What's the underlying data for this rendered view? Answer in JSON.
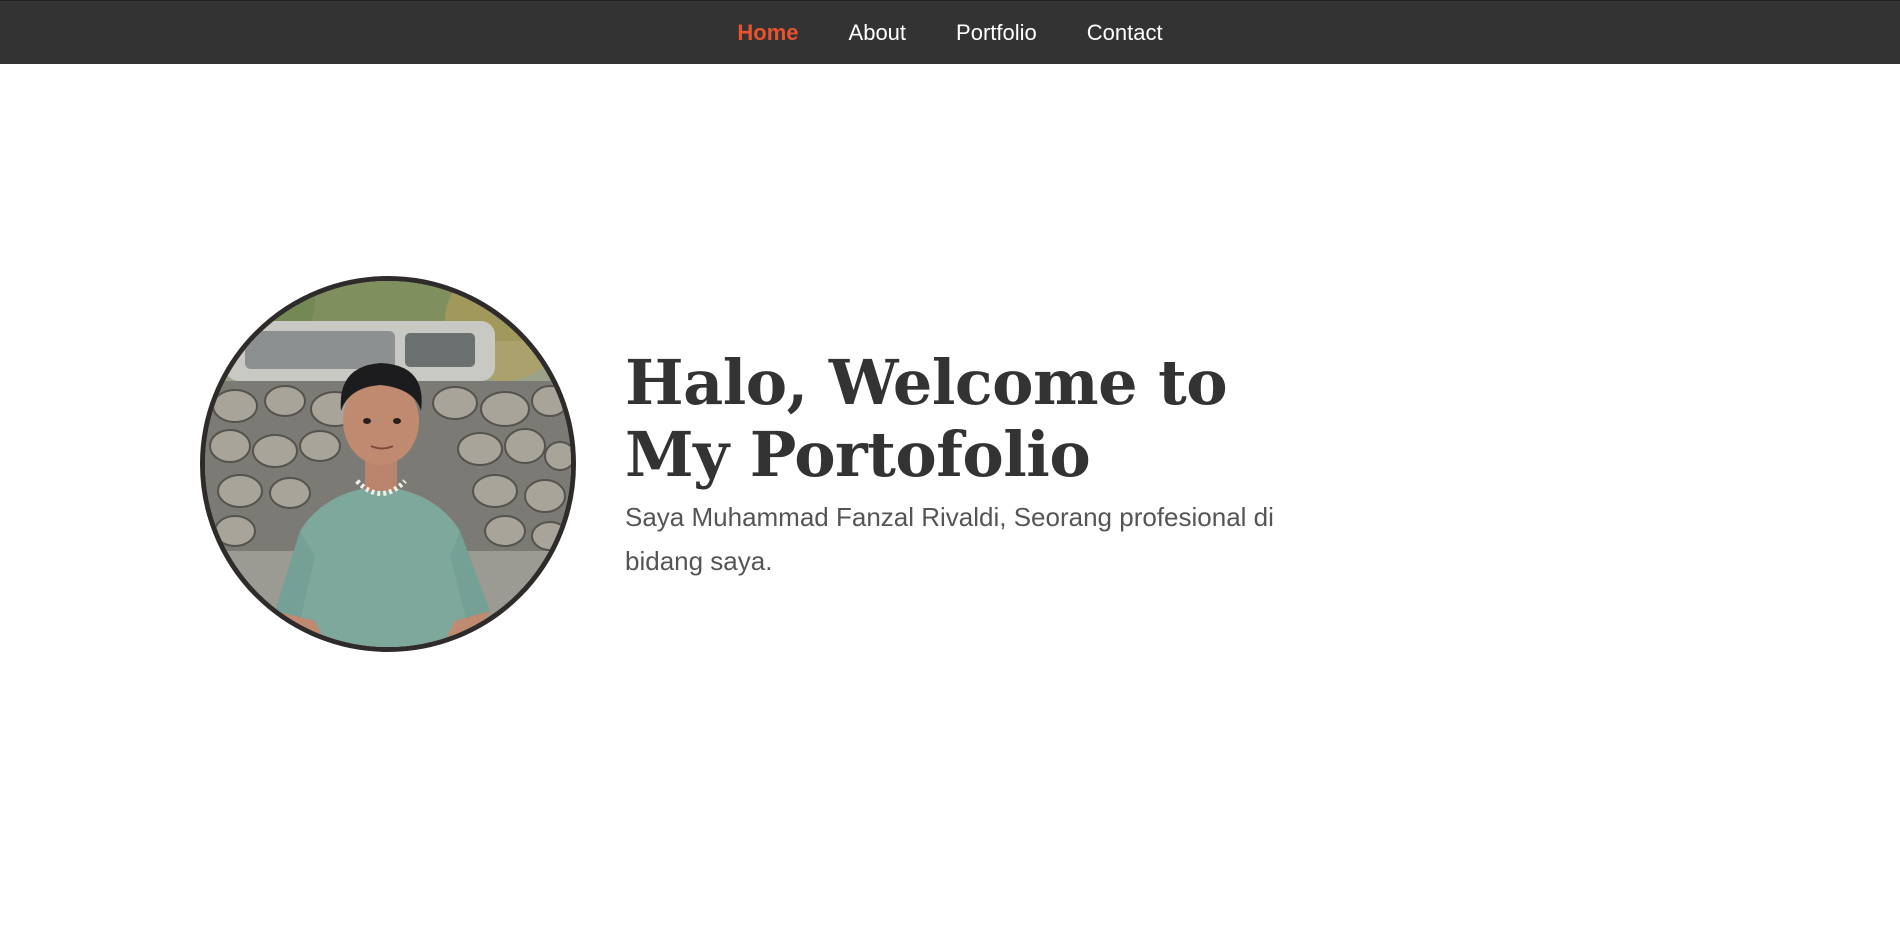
{
  "nav": {
    "items": [
      {
        "label": "Home",
        "active": true
      },
      {
        "label": "About",
        "active": false
      },
      {
        "label": "Portfolio",
        "active": false
      },
      {
        "label": "Contact",
        "active": false
      }
    ]
  },
  "hero": {
    "title": "Halo, Welcome to My Portofolio",
    "subtitle": "Saya Muhammad Fanzal Rivaldi, Seorang profesional di bidang saya.",
    "avatar_icon": "profile-photo"
  },
  "colors": {
    "navbar_bg": "#333333",
    "nav_active": "#e8532d",
    "nav_text": "#ffffff",
    "title_text": "#333333",
    "subtitle_text": "#555555",
    "avatar_border": "#2f2b2b"
  }
}
